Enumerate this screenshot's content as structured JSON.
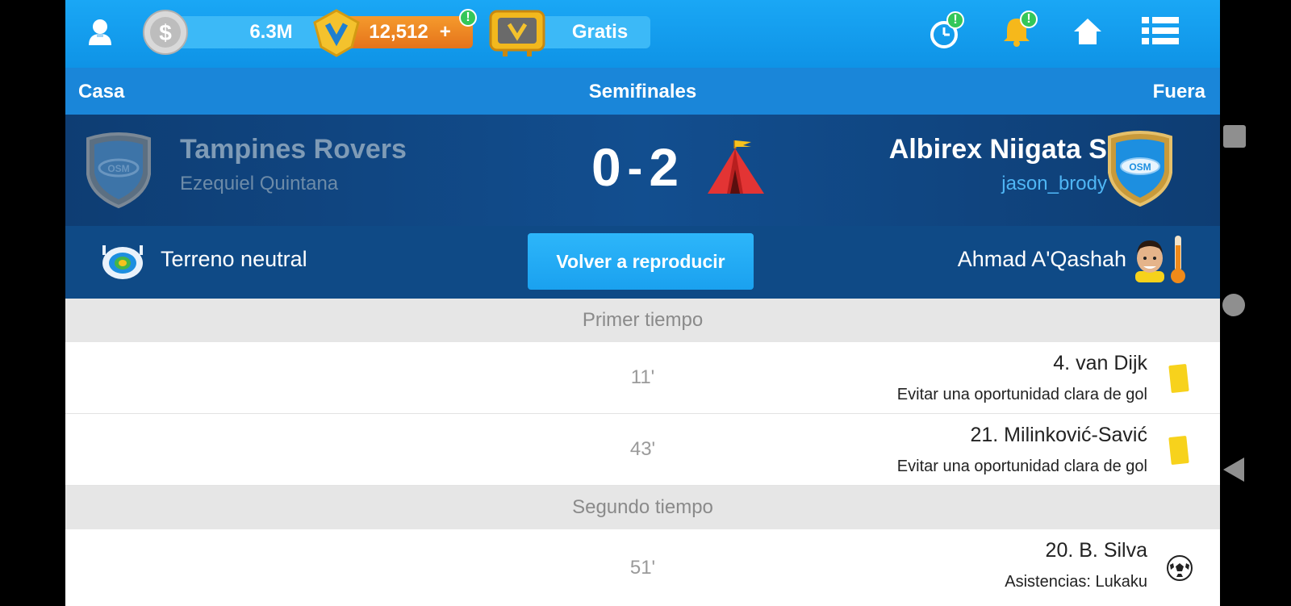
{
  "topbar": {
    "coins": "6.3M",
    "credits": "12,512",
    "credits_plus": "+",
    "credits_badge": "!",
    "tv_label": "Gratis",
    "alerts": [
      "!",
      "!"
    ]
  },
  "header": {
    "home_label": "Casa",
    "round": "Semifinales",
    "away_label": "Fuera"
  },
  "match": {
    "home_team": "Tampines Rovers",
    "home_manager": "Ezequiel Quintana",
    "score_home": "0",
    "score_sep": "-",
    "score_away": "2",
    "away_team": "Albirex Niigata S",
    "away_manager": "jason_brody",
    "badge_text": "OSM"
  },
  "info": {
    "stadium": "Terreno neutral",
    "replay_button": "Volver a reproducir",
    "referee": "Ahmad A'Qashah"
  },
  "timeline": {
    "first_half": "Primer tiempo",
    "second_half": "Segundo tiempo",
    "events": [
      {
        "minute": "11'",
        "player": "4. van Dijk",
        "detail": "Evitar una oportunidad clara de gol",
        "icon": "yellow-card-icon"
      },
      {
        "minute": "43'",
        "player": "21. Milinković-Savić",
        "detail": "Evitar una oportunidad clara de gol",
        "icon": "yellow-card-icon"
      },
      {
        "minute": "51'",
        "player": "20. B. Silva",
        "detail": "Asistencias: Lukaku",
        "icon": "goal-ball-icon"
      }
    ]
  }
}
